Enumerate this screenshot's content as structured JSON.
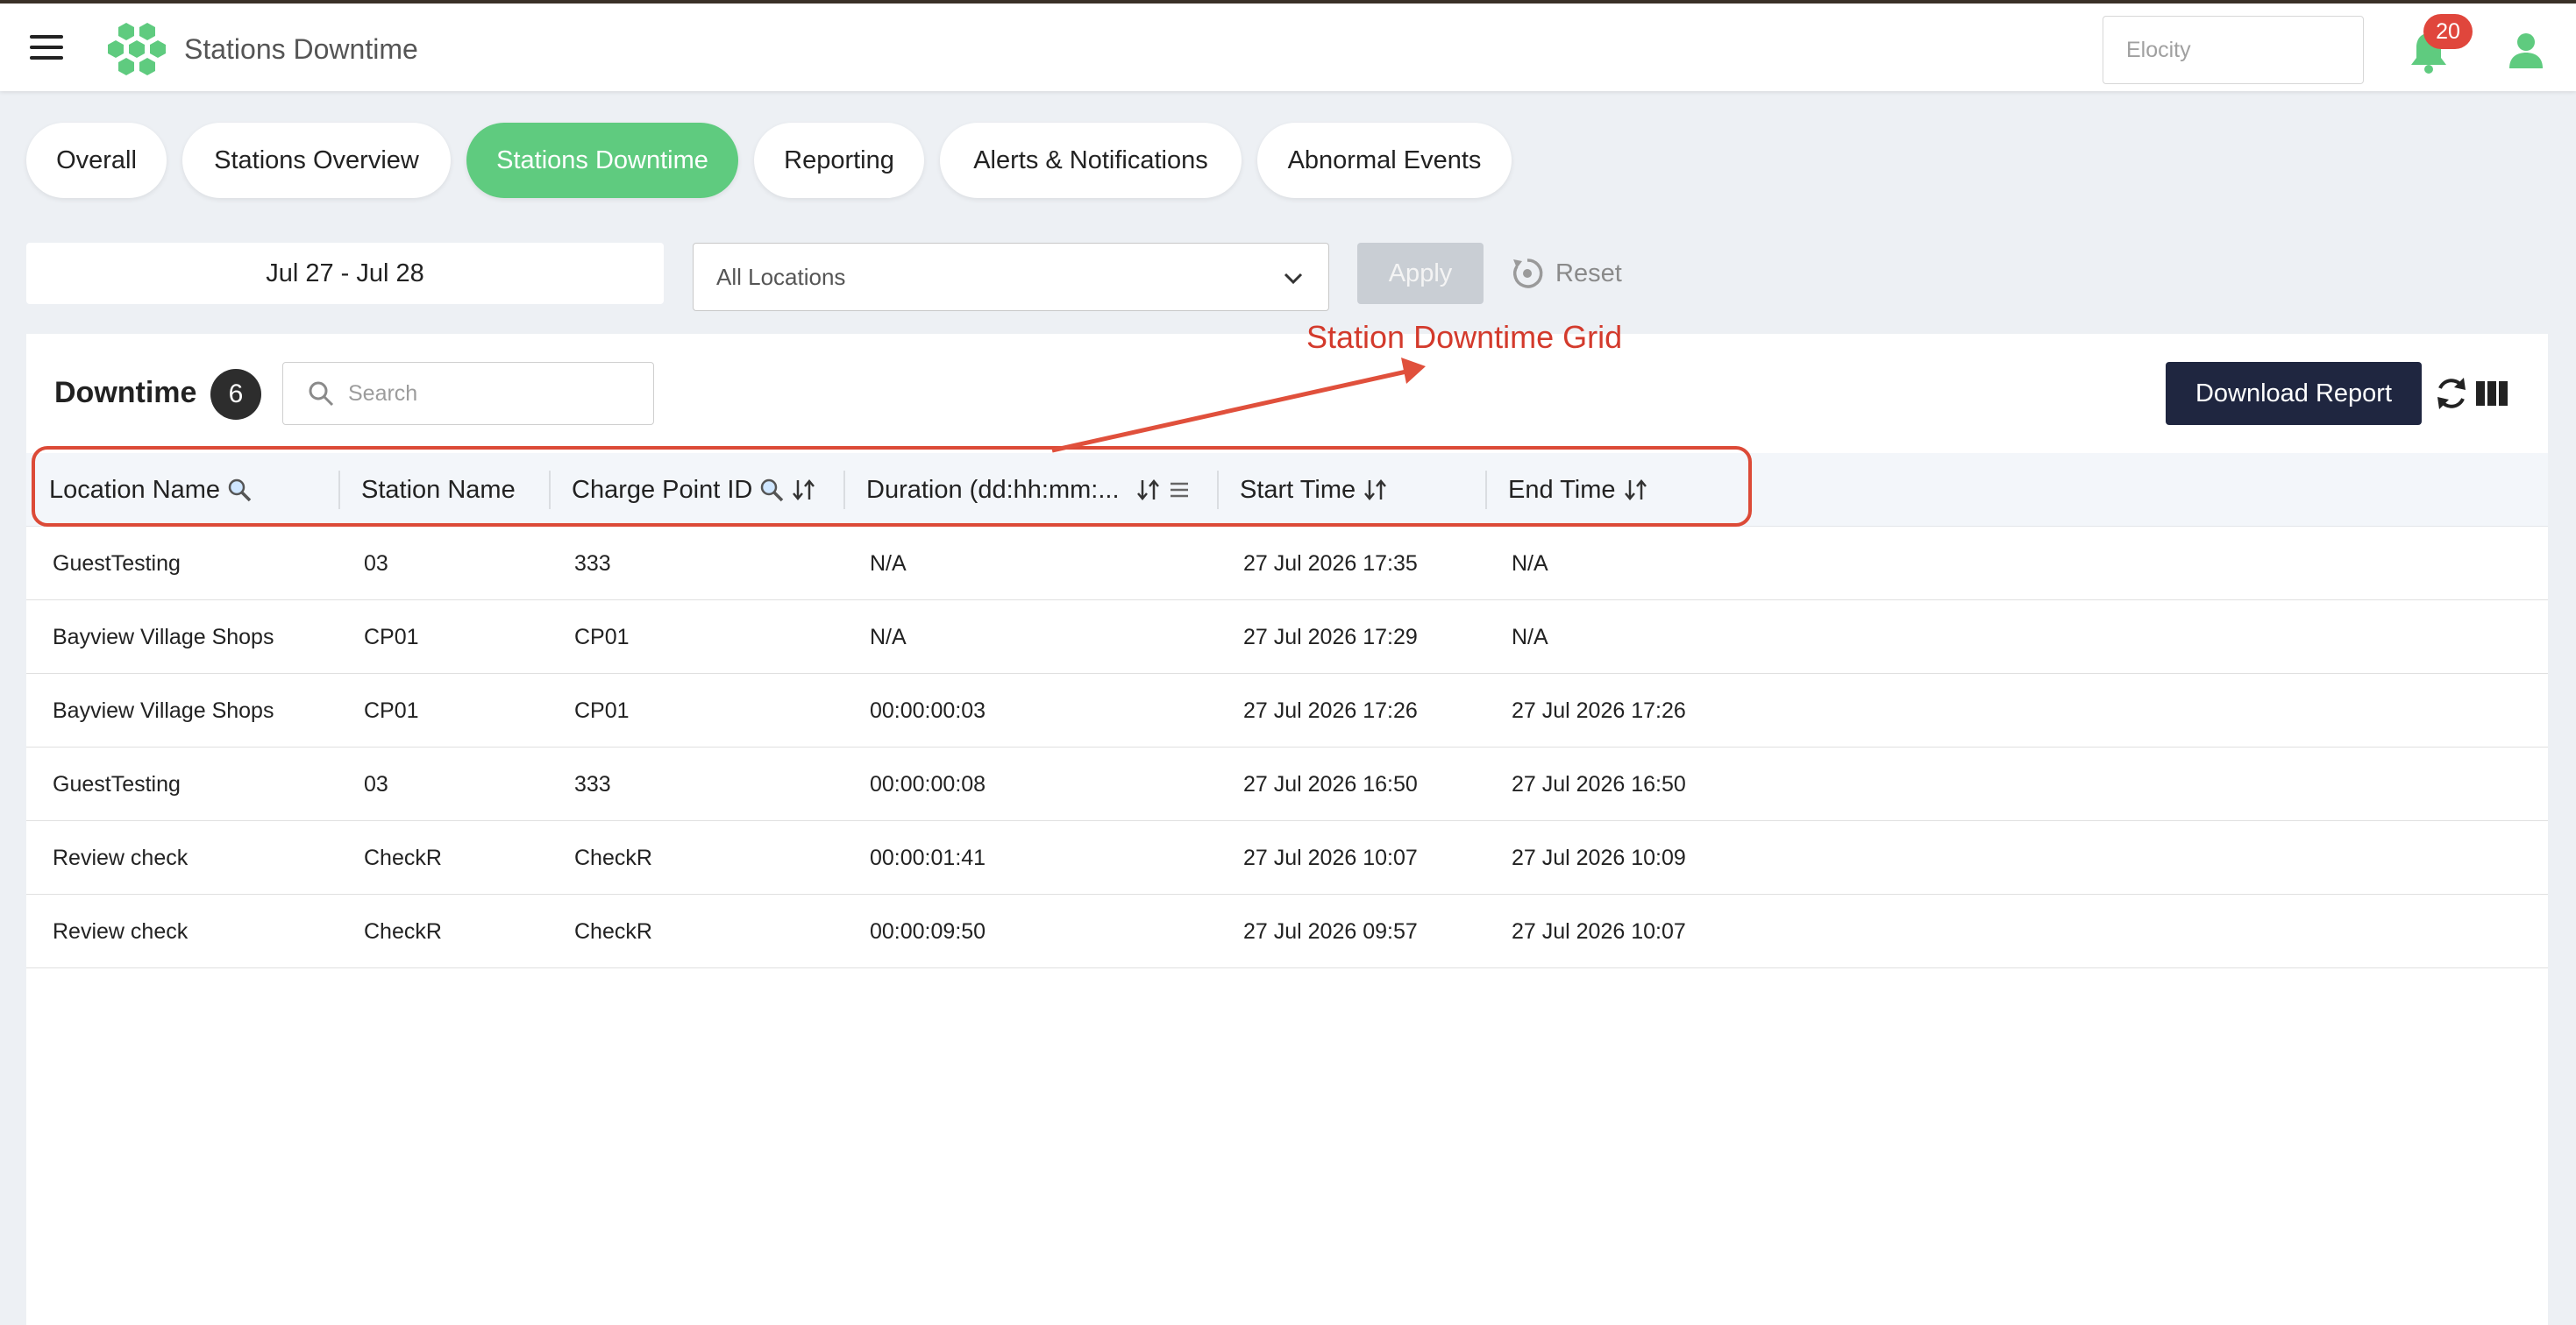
{
  "header": {
    "app_title": "Stations Downtime",
    "tenant_placeholder": "Elocity",
    "notification_count": "20",
    "icons": {
      "menu": "hamburger-icon",
      "logo": "hexagon-cluster-logo",
      "bell": "bell-icon",
      "user": "user-icon"
    },
    "accent_color": "#5fcb7f"
  },
  "tabs": [
    {
      "label": "Overall",
      "active": false
    },
    {
      "label": "Stations Overview",
      "active": false
    },
    {
      "label": "Stations Downtime",
      "active": true
    },
    {
      "label": "Reporting",
      "active": false
    },
    {
      "label": "Alerts & Notifications",
      "active": false
    },
    {
      "label": "Abnormal Events",
      "active": false
    }
  ],
  "filters": {
    "date_range": "Jul 27 - Jul 28",
    "location": "All Locations",
    "apply_label": "Apply",
    "reset_label": "Reset"
  },
  "grid": {
    "title": "Downtime",
    "count": "6",
    "search_placeholder": "Search",
    "download_label": "Download Report",
    "columns": [
      {
        "label": "Location Name",
        "icons": [
          "search-icon"
        ]
      },
      {
        "label": "Station Name",
        "icons": []
      },
      {
        "label": "Charge Point ID",
        "icons": [
          "search-icon",
          "sort-icon"
        ]
      },
      {
        "label": "Duration (dd:hh:mm:...",
        "icons": [
          "sort-icon",
          "menu-lines-icon"
        ]
      },
      {
        "label": "Start Time",
        "icons": [
          "sort-icon"
        ]
      },
      {
        "label": "End Time",
        "icons": [
          "sort-icon"
        ]
      }
    ],
    "rows": [
      [
        "GuestTesting",
        "03",
        "333",
        "N/A",
        "27 Jul 2026 17:35",
        "N/A"
      ],
      [
        "Bayview Village Shops",
        "CP01",
        "CP01",
        "N/A",
        "27 Jul 2026 17:29",
        "N/A"
      ],
      [
        "Bayview Village Shops",
        "CP01",
        "CP01",
        "00:00:00:03",
        "27 Jul 2026 17:26",
        "27 Jul 2026 17:26"
      ],
      [
        "GuestTesting",
        "03",
        "333",
        "00:00:00:08",
        "27 Jul 2026 16:50",
        "27 Jul 2026 16:50"
      ],
      [
        "Review check",
        "CheckR",
        "CheckR",
        "00:00:01:41",
        "27 Jul 2026 10:07",
        "27 Jul 2026 10:09"
      ],
      [
        "Review check",
        "CheckR",
        "CheckR",
        "00:00:09:50",
        "27 Jul 2026 09:57",
        "27 Jul 2026 10:07"
      ]
    ]
  },
  "annotation": {
    "label": "Station Downtime Grid",
    "color": "#d33a2c"
  }
}
